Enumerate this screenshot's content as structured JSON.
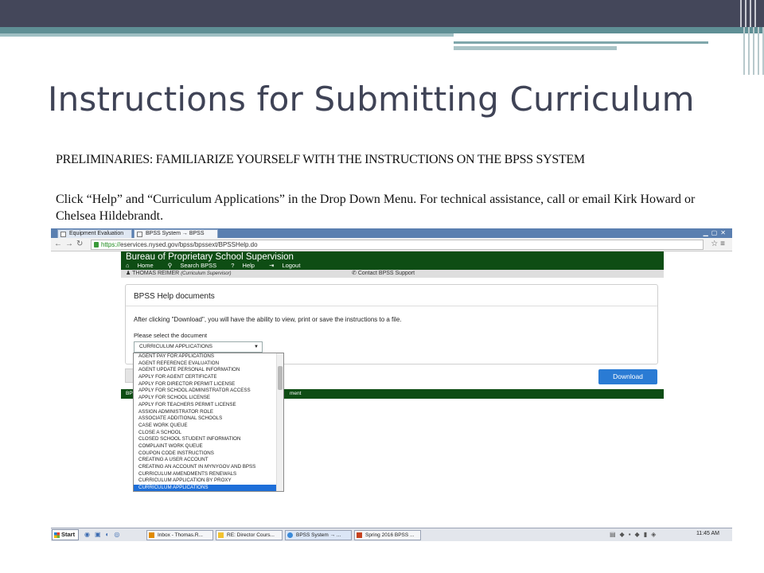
{
  "slide": {
    "title": "Instructions for Submitting Curriculum",
    "preliminaries": "PRELIMINARIES: FAMILIARIZE YOURSELF WITH THE INSTRUCTIONS ON THE BPSS SYSTEM",
    "instructions": "Click “Help” and “Curriculum Applications” in the Drop Down Menu. For technical assistance, call or email Kirk Howard or Chelsea Hildebrandt."
  },
  "browser": {
    "tabs": [
      {
        "label": "Equipment Evaluation"
      },
      {
        "label": "BPSS System → BPSS"
      }
    ],
    "url_scheme": "https://",
    "url_rest": "eservices.nysed.gov/bpss/bpssext/BPSSHelp.do"
  },
  "app": {
    "title": "Bureau of Proprietary School Supervision",
    "nav": {
      "home": "Home",
      "search": "Search BPSS",
      "help": "Help",
      "logout": "Logout"
    },
    "user": {
      "name": "THOMAS REIMER",
      "role": "(Curriculum Supervisor)"
    },
    "support": "Contact BPSS Support"
  },
  "panel": {
    "title": "BPSS Help documents",
    "info": "After clicking \"Download\", you will have the ability to view, print or save the instructions to a file.",
    "select_label": "Please select the document",
    "selected_value": "CURRICULUM APPLICATIONS",
    "download_label": "Download"
  },
  "footer": {
    "left": "BP",
    "right": "ment"
  },
  "dropdown": {
    "options": [
      "AGENT PAY FOR APPLICATIONS",
      "AGENT REFERENCE EVALUATION",
      "AGENT UPDATE PERSONAL INFORMATION",
      "APPLY FOR AGENT CERTIFICATE",
      "APPLY FOR DIRECTOR PERMIT LICENSE",
      "APPLY FOR SCHOOL ADMINISTRATOR ACCESS",
      "APPLY FOR SCHOOL LICENSE",
      "APPLY FOR TEACHERS PERMIT LICENSE",
      "ASSIGN ADMINISTRATOR ROLE",
      "ASSOCIATE ADDITIONAL SCHOOLS",
      "CASE WORK QUEUE",
      "CLOSE A SCHOOL",
      "CLOSED SCHOOL STUDENT INFORMATION",
      "COMPLAINT WORK QUEUE",
      "COUPON CODE INSTRUCTIONS",
      "CREATING A USER ACCOUNT",
      "CREATING AN ACCOUNT IN MYNYGOV AND BPSS",
      "CURRICULUM AMENDMENTS RENEWALS",
      "CURRICULUM APPLICATION BY PROXY",
      "CURRICULUM APPLICATIONS"
    ],
    "selected_index": 19
  },
  "taskbar": {
    "start": "Start",
    "tasks": [
      {
        "label": "Inbox - Thomas.R..."
      },
      {
        "label": "RE: Director Cours..."
      },
      {
        "label": "BPSS System → ..."
      },
      {
        "label": "Spring 2016 BPSS ..."
      }
    ],
    "clock": "11:45 AM"
  }
}
